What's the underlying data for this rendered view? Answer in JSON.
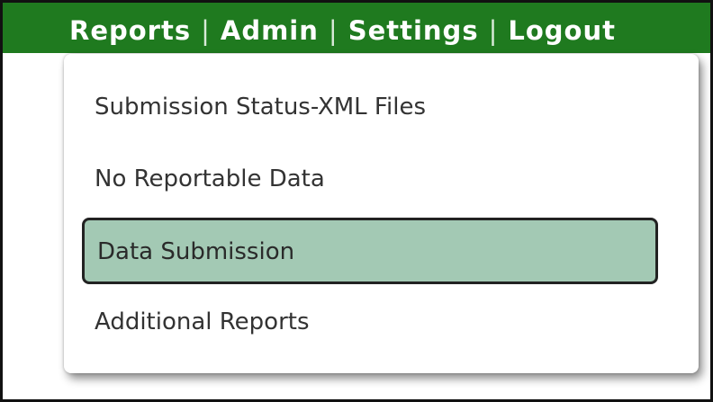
{
  "nav": {
    "links": [
      "Reports",
      "Admin",
      "Settings",
      "Logout"
    ],
    "separator": "|",
    "background_color": "#1f7a1f",
    "text_color": "#ffffff"
  },
  "dropdown": {
    "items": [
      {
        "label": "Submission Status-XML Files",
        "highlighted": false
      },
      {
        "label": "No Reportable Data",
        "highlighted": false
      },
      {
        "label": "Data Submission",
        "highlighted": true
      },
      {
        "label": "Additional Reports",
        "highlighted": false
      }
    ],
    "highlight_color": "#a3c9b4"
  }
}
